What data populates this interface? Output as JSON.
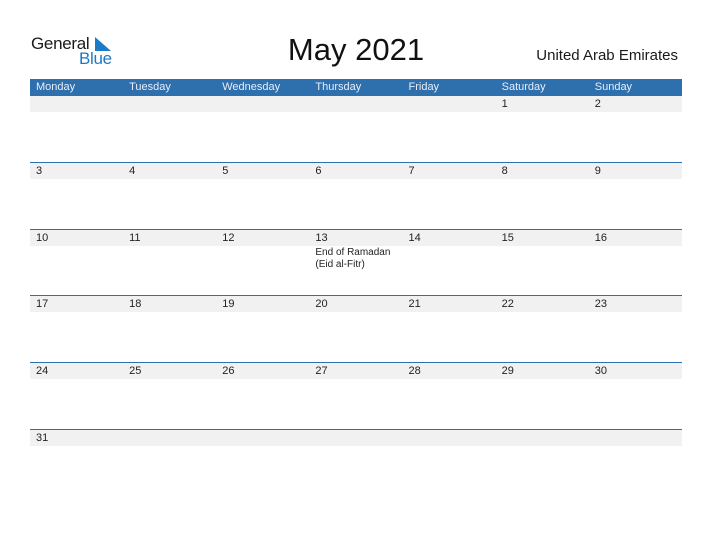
{
  "brand": {
    "word1": "General",
    "word2": "Blue",
    "accent_color": "#1e7ac4"
  },
  "title": "May 2021",
  "country": "United Arab Emirates",
  "header_color": "#2e6fae",
  "weekdays": [
    "Monday",
    "Tuesday",
    "Wednesday",
    "Thursday",
    "Friday",
    "Saturday",
    "Sunday"
  ],
  "weeks": [
    {
      "days": [
        {
          "day": "",
          "event": ""
        },
        {
          "day": "",
          "event": ""
        },
        {
          "day": "",
          "event": ""
        },
        {
          "day": "",
          "event": ""
        },
        {
          "day": "",
          "event": ""
        },
        {
          "day": "1",
          "event": ""
        },
        {
          "day": "2",
          "event": ""
        }
      ]
    },
    {
      "days": [
        {
          "day": "3",
          "event": ""
        },
        {
          "day": "4",
          "event": ""
        },
        {
          "day": "5",
          "event": ""
        },
        {
          "day": "6",
          "event": ""
        },
        {
          "day": "7",
          "event": ""
        },
        {
          "day": "8",
          "event": ""
        },
        {
          "day": "9",
          "event": ""
        }
      ]
    },
    {
      "days": [
        {
          "day": "10",
          "event": ""
        },
        {
          "day": "11",
          "event": ""
        },
        {
          "day": "12",
          "event": ""
        },
        {
          "day": "13",
          "event": "End of Ramadan (Eid al-Fitr)",
          "event_line1": "End of Ramadan",
          "event_line2": "(Eid al-Fitr)"
        },
        {
          "day": "14",
          "event": ""
        },
        {
          "day": "15",
          "event": ""
        },
        {
          "day": "16",
          "event": ""
        }
      ]
    },
    {
      "days": [
        {
          "day": "17",
          "event": ""
        },
        {
          "day": "18",
          "event": ""
        },
        {
          "day": "19",
          "event": ""
        },
        {
          "day": "20",
          "event": ""
        },
        {
          "day": "21",
          "event": ""
        },
        {
          "day": "22",
          "event": ""
        },
        {
          "day": "23",
          "event": ""
        }
      ]
    },
    {
      "days": [
        {
          "day": "24",
          "event": ""
        },
        {
          "day": "25",
          "event": ""
        },
        {
          "day": "26",
          "event": ""
        },
        {
          "day": "27",
          "event": ""
        },
        {
          "day": "28",
          "event": ""
        },
        {
          "day": "29",
          "event": ""
        },
        {
          "day": "30",
          "event": ""
        }
      ]
    },
    {
      "days": [
        {
          "day": "31",
          "event": ""
        },
        {
          "day": "",
          "event": ""
        },
        {
          "day": "",
          "event": ""
        },
        {
          "day": "",
          "event": ""
        },
        {
          "day": "",
          "event": ""
        },
        {
          "day": "",
          "event": ""
        },
        {
          "day": "",
          "event": ""
        }
      ]
    }
  ]
}
